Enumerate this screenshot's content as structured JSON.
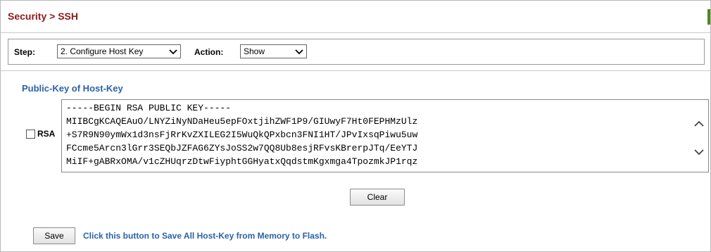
{
  "header": {
    "title": "Security > SSH"
  },
  "step": {
    "step_label": "Step:",
    "step_value": "2. Configure Host Key",
    "action_label": "Action:",
    "action_value": "Show"
  },
  "section": {
    "title": "Public-Key of Host-Key"
  },
  "rsa": {
    "label": "RSA",
    "checked": false,
    "key_lines": [
      "-----BEGIN RSA PUBLIC KEY-----",
      "MIIBCgKCAQEAuO/LNYZiNyNDaHeu5epFOxtjihZWF1P9/GIUwyF7Ht0FEPHMzUlz",
      "+S7R9N90ymWx1d3nsFjRrKvZXILEG2I5WuQkQPxbcn3FNI1HT/JPvIxsqPiwu5uw",
      "FCcme5Arcn3lGrr3SEQbJZFAG6ZYsJoSS2w7QQ8Ub8esjRFvsKBrerpJTq/EeYTJ",
      "MiIF+gABRxOMA/v1cZHUqrzDtwFiyphtGGHyatxQqdstmKgxmga4TpozmkJP1rqz"
    ]
  },
  "buttons": {
    "clear": "Clear",
    "save": "Save"
  },
  "footer": {
    "hint": "Click this button to Save All Host-Key from Memory to Flash."
  },
  "colors": {
    "title": "#8b1a1a",
    "section": "#2a62a6",
    "accent": "#4b8a1f"
  }
}
